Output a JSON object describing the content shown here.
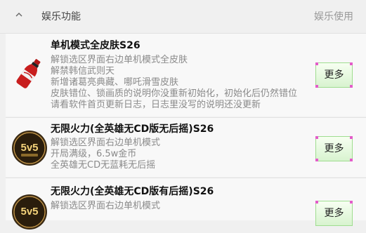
{
  "header": {
    "title": "娱乐功能",
    "right_label": "娱乐使用",
    "chevron_icon": "chevron-up-icon"
  },
  "items": [
    {
      "title": "单机模式全皮肤S26",
      "icon": "cola-bottle-icon",
      "lines": [
        "解锁选区界面右边单机模式全皮肤",
        "解禁韩信武则天",
        "新增诸葛亮典藏、哪吒滑雪皮肤",
        "皮肤错位、锁画质的说明你没重新初始化，初始化后仍然错位",
        "请看软件首页更新日志，日志里没写的说明还没更新"
      ],
      "button": "更多"
    },
    {
      "title": "无限火力(全英雄无CD版无后摇)S26",
      "icon": "5v5-logo-icon",
      "icon_text": "5v5",
      "lines": [
        "解锁选区界面右边单机模式",
        "开局满级，6.5w金币",
        "全英雄无CD无蓝耗无后摇"
      ],
      "button": "更多"
    },
    {
      "title": "无限火力(全英雄无CD版有后摇)S26",
      "icon": "5v5-logo-icon",
      "icon_text": "5v5",
      "lines": [
        "解锁选区界面右边单机模式"
      ],
      "button": "更多"
    }
  ],
  "colors": {
    "background": "#f0f0f0",
    "card": "#f8f8f8",
    "button_green": "#d8f3cf",
    "accent_pink": "#e35cc9"
  }
}
